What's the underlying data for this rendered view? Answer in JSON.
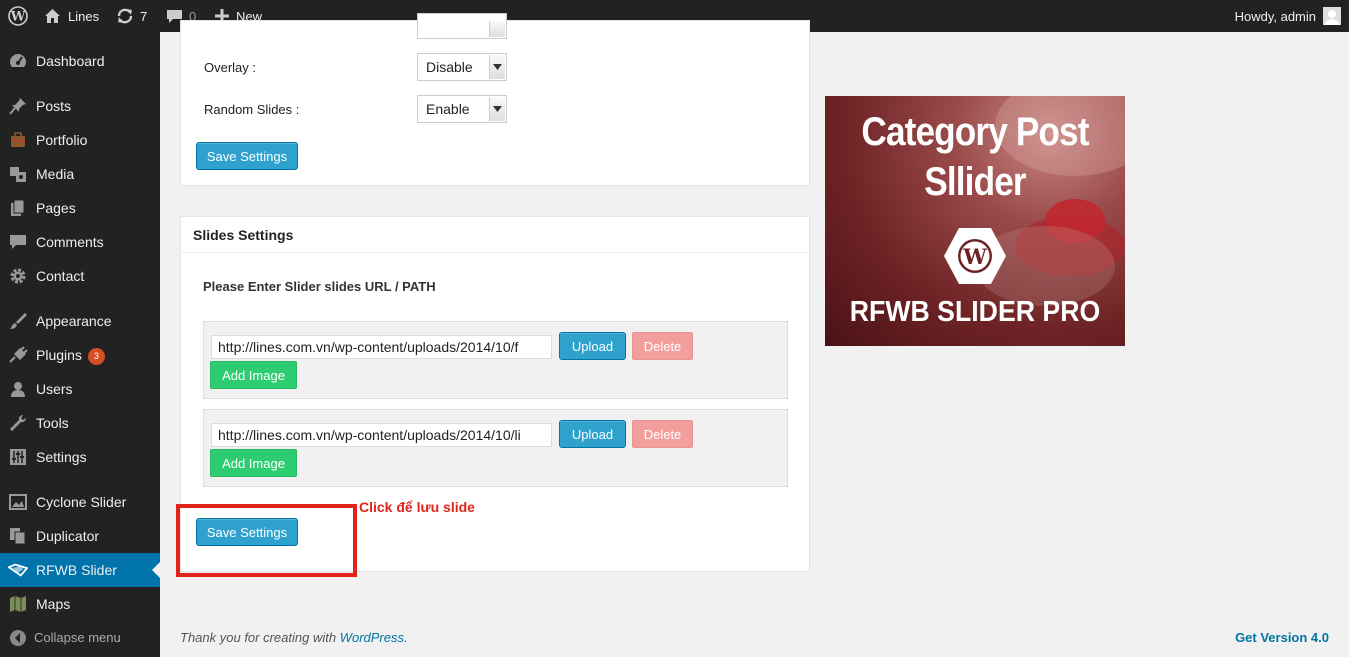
{
  "adminbar": {
    "site_name": "Lines",
    "updates_count": "7",
    "comments_count": "0",
    "new_label": "New",
    "greeting": "Howdy, admin"
  },
  "sidebar": {
    "items": [
      {
        "label": "Dashboard",
        "icon": "dashboard-icon"
      },
      {
        "label": "Posts",
        "icon": "pin-icon"
      },
      {
        "label": "Portfolio",
        "icon": "briefcase-icon"
      },
      {
        "label": "Media",
        "icon": "media-icon"
      },
      {
        "label": "Pages",
        "icon": "pages-icon"
      },
      {
        "label": "Comments",
        "icon": "comment-icon"
      },
      {
        "label": "Contact",
        "icon": "gear-icon"
      },
      {
        "label": "Appearance",
        "icon": "brush-icon"
      },
      {
        "label": "Plugins",
        "icon": "plugin-icon",
        "badge": "3"
      },
      {
        "label": "Users",
        "icon": "user-icon"
      },
      {
        "label": "Tools",
        "icon": "wrench-icon"
      },
      {
        "label": "Settings",
        "icon": "sliders-icon"
      },
      {
        "label": "Cyclone Slider",
        "icon": "image-icon"
      },
      {
        "label": "Duplicator",
        "icon": "duplicate-icon"
      },
      {
        "label": "RFWB Slider",
        "icon": "slider-icon",
        "current": true
      },
      {
        "label": "Maps",
        "icon": "map-icon"
      }
    ],
    "collapse_label": "Collapse menu"
  },
  "general": {
    "overlay_label": "Overlay :",
    "overlay_value": "Disable",
    "random_label": "Random Slides :",
    "random_value": "Enable",
    "save_label": "Save Settings"
  },
  "slides": {
    "heading": "Slides Settings",
    "instruction": "Please Enter Slider slides URL / PATH",
    "rows": [
      {
        "url": "http://lines.com.vn/wp-content/uploads/2014/10/f",
        "upload": "Upload",
        "delete": "Delete",
        "add": "Add Image"
      },
      {
        "url": "http://lines.com.vn/wp-content/uploads/2014/10/li",
        "upload": "Upload",
        "delete": "Delete",
        "add": "Add Image"
      }
    ],
    "save_label": "Save Settings"
  },
  "annotation": "Click để lưu slide",
  "banner": {
    "line1": "Category Post",
    "line2": "Sllider",
    "line3": "RFWB SLIDER PRO"
  },
  "footer": {
    "thanks_prefix": "Thank you for creating with",
    "thanks_link": "WordPress",
    "thanks_suffix": ".",
    "version": "Get Version 4.0"
  },
  "colors": {
    "adminbar_bg": "#222222",
    "current_menu": "#0073aa",
    "primary_button": "#2ea2cc",
    "delete_button": "#f19e9c",
    "add_button": "#2ecc71",
    "annotation": "#e2231a"
  }
}
